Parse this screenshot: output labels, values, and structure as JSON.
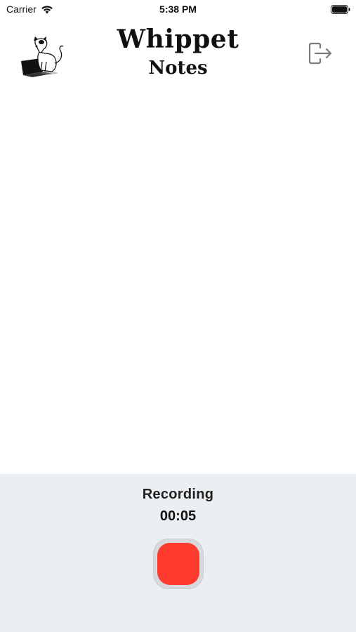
{
  "status_bar": {
    "carrier": "Carrier",
    "time": "5:38 PM",
    "wifi_icon": "wifi-icon",
    "battery_icon": "battery-icon"
  },
  "header": {
    "title": "Whippet",
    "subtitle": "Notes",
    "logo_icon": "whippet-laptop-logo",
    "logout_icon": "logout-icon"
  },
  "recording": {
    "label": "Recording",
    "timer": "00:05",
    "button_icon": "stop-icon",
    "button_color": "#ff3b30"
  },
  "colors": {
    "panel_background": "#eceff1",
    "text": "#111111"
  }
}
